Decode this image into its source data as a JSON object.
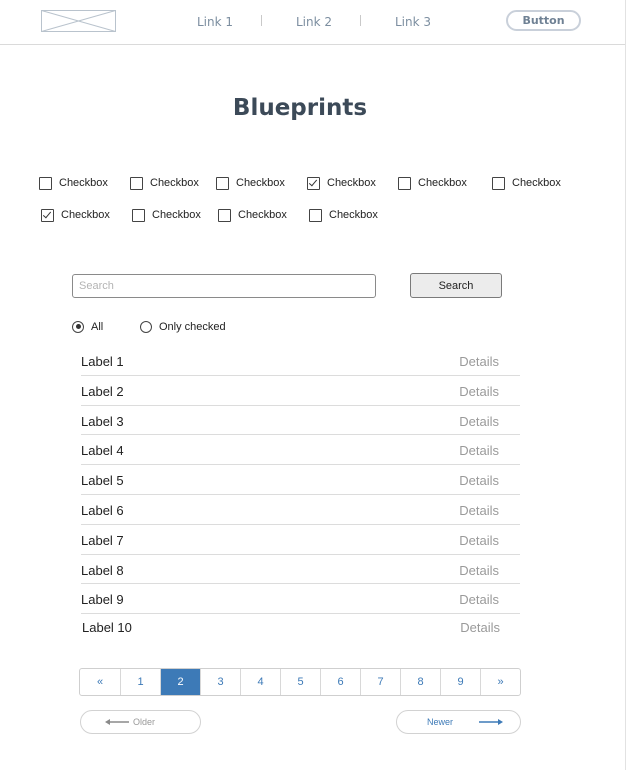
{
  "header": {
    "nav": [
      "Link 1",
      "Link 2",
      "Link 3"
    ],
    "button_label": "Button"
  },
  "title": "Blueprints",
  "checkboxes": [
    {
      "label": "Checkbox",
      "checked": false
    },
    {
      "label": "Checkbox",
      "checked": false
    },
    {
      "label": "Checkbox",
      "checked": false
    },
    {
      "label": "Checkbox",
      "checked": true
    },
    {
      "label": "Checkbox",
      "checked": false
    },
    {
      "label": "Checkbox",
      "checked": false
    },
    {
      "label": "Checkbox",
      "checked": true
    },
    {
      "label": "Checkbox",
      "checked": false
    },
    {
      "label": "Checkbox",
      "checked": false
    },
    {
      "label": "Checkbox",
      "checked": false
    }
  ],
  "search": {
    "placeholder": "Search",
    "value": "",
    "button_label": "Search"
  },
  "filter": {
    "options": [
      "All",
      "Only checked"
    ],
    "selected": "All"
  },
  "list": {
    "details_label": "Details",
    "items": [
      "Label 1",
      "Label 2",
      "Label 3",
      "Label 4",
      "Label 5",
      "Label 6",
      "Label 7",
      "Label 8",
      "Label 9",
      "Label 10"
    ]
  },
  "pagination": {
    "prev": "«",
    "next": "»",
    "pages": [
      "1",
      "2",
      "3",
      "4",
      "5",
      "6",
      "7",
      "8",
      "9"
    ],
    "current": "2",
    "accent_color": "#3d7ab7"
  },
  "older_label": "Older",
  "newer_label": "Newer"
}
